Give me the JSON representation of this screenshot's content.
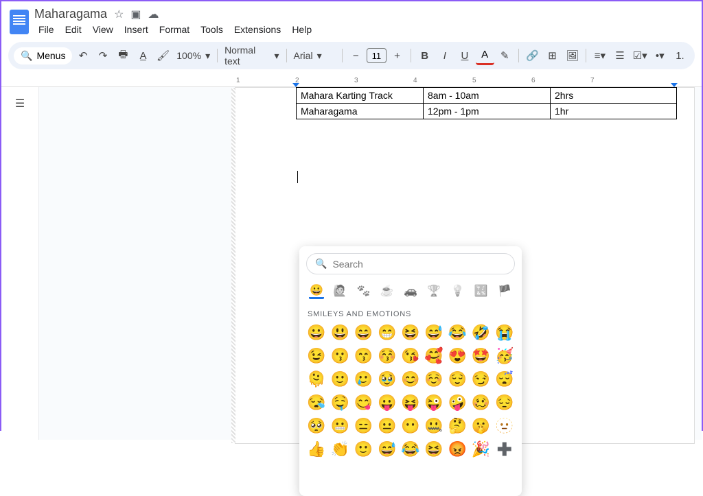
{
  "header": {
    "title": "Maharagama"
  },
  "menubar": [
    "File",
    "Edit",
    "View",
    "Insert",
    "Format",
    "Tools",
    "Extensions",
    "Help"
  ],
  "toolbar": {
    "menus": "Menus",
    "zoom": "100%",
    "style": "Normal text",
    "font": "Arial",
    "size": "11"
  },
  "ruler": {
    "labels": [
      "1",
      "2",
      "3",
      "4",
      "5",
      "6",
      "7"
    ]
  },
  "table": {
    "rows": [
      [
        "Mahara Karting Track",
        "8am - 10am",
        "2hrs"
      ],
      [
        "Maharagama",
        "12pm - 1pm",
        "1hr"
      ]
    ]
  },
  "emoji_picker": {
    "search_placeholder": "Search",
    "category_label": "SMILEYS AND EMOTIONS",
    "categories": [
      "smiley-icon",
      "person-icon",
      "animal-icon",
      "food-icon",
      "travel-icon",
      "activity-icon",
      "object-icon",
      "symbol-icon",
      "flag-icon"
    ],
    "category_glyphs": [
      "😀",
      "🙋",
      "🐾",
      "☕",
      "🚗",
      "🏆",
      "💡",
      "🔣",
      "🏴"
    ],
    "emojis": [
      "😀",
      "😃",
      "😄",
      "😁",
      "😆",
      "😅",
      "😂",
      "🤣",
      "😭",
      "😉",
      "😗",
      "😙",
      "😚",
      "😘",
      "🥰",
      "😍",
      "🤩",
      "🥳",
      "🫠",
      "🙂",
      "🥲",
      "🥹",
      "😊",
      "☺️",
      "😌",
      "😏",
      "😴",
      "😪",
      "🤤",
      "😋",
      "😛",
      "😝",
      "😜",
      "🤪",
      "🥴",
      "😔",
      "🥺",
      "😬",
      "😑",
      "😐",
      "😶",
      "🤐",
      "🤔",
      "🤫",
      "🫥",
      "👍",
      "👏",
      "🙂",
      "😅",
      "😂",
      "😆",
      "😡",
      "🎉",
      "➕"
    ]
  }
}
